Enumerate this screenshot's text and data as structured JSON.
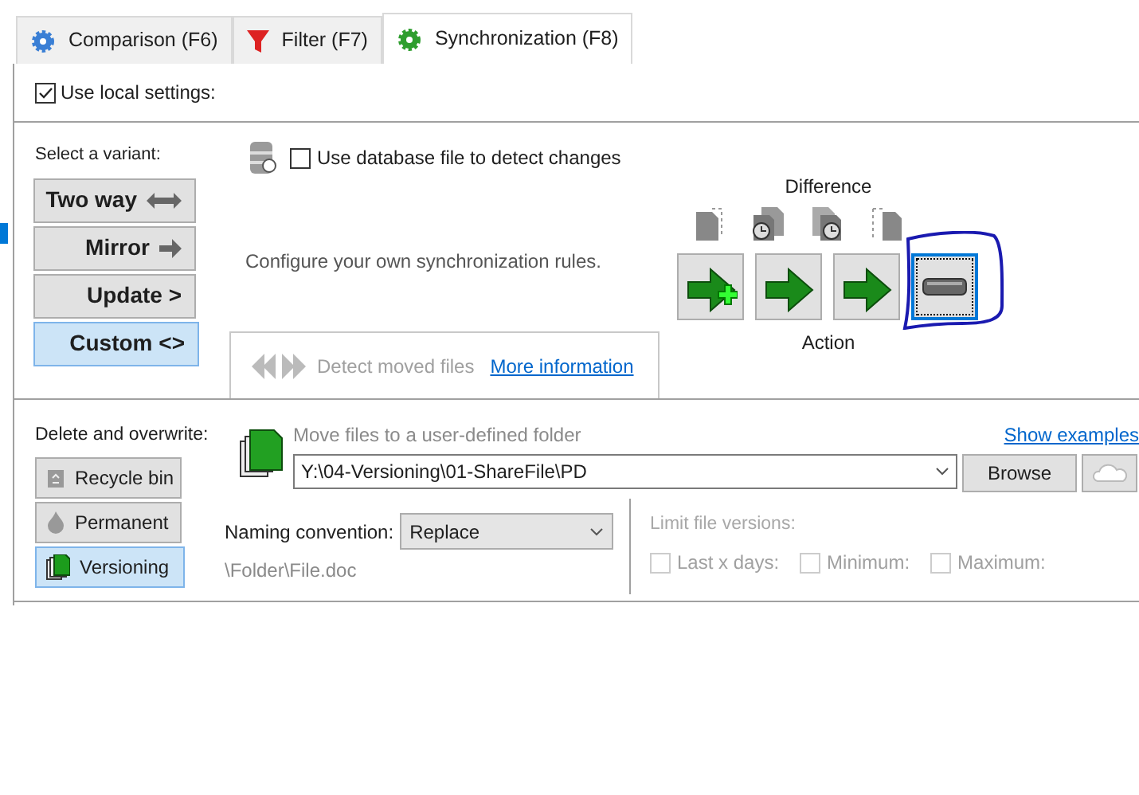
{
  "tabs": [
    {
      "label": "Comparison (F6)",
      "kind": "gear",
      "selected": false
    },
    {
      "label": "Filter (F7)",
      "kind": "funnel",
      "selected": false
    },
    {
      "label": "Synchronization (F8)",
      "kind": "sync",
      "selected": true
    }
  ],
  "local_settings": {
    "label": "Use local settings:",
    "checked": true
  },
  "variants": {
    "label": "Select a variant:",
    "options": [
      {
        "label": "Two way",
        "kind": "two_way",
        "selected": false
      },
      {
        "label": "Mirror",
        "kind": "mirror",
        "selected": false
      },
      {
        "label": "Update >",
        "kind": "text",
        "selected": false
      },
      {
        "label": "Custom <>",
        "kind": "text",
        "selected": true
      }
    ]
  },
  "database": {
    "label": "Use database file to detect changes",
    "checked": false
  },
  "description": "Configure your own synchronization rules.",
  "detect_moved": {
    "label": "Detect moved files",
    "disabled": true,
    "link": "More information"
  },
  "difference_label": "Difference",
  "actions": [
    {
      "kind": "create",
      "selected": false
    },
    {
      "kind": "update",
      "selected": false
    },
    {
      "kind": "update",
      "selected": false
    },
    {
      "kind": "none",
      "selected": true
    }
  ],
  "action_label": "Action",
  "deletion": {
    "label": "Delete and overwrite:",
    "options": [
      {
        "label": "Recycle bin",
        "kind": "recycle",
        "selected": false
      },
      {
        "label": "Permanent",
        "kind": "flame",
        "selected": false
      },
      {
        "label": "Versioning",
        "kind": "versioning",
        "selected": true
      }
    ]
  },
  "versioning": {
    "title": "Move files to a user-defined folder",
    "link": "Show examples",
    "folder": "Y:\\04-Versioning\\01-ShareFile\\PD",
    "browse": "Browse",
    "naming_label": "Naming convention:",
    "naming_value": "Replace",
    "example": "\\Folder\\File.doc"
  },
  "limit": {
    "label": "Limit file versions:",
    "disabled": true,
    "options": [
      {
        "label": "Last x days:",
        "checked": false
      },
      {
        "label": "Minimum:",
        "checked": false
      },
      {
        "label": "Maximum:",
        "checked": false
      }
    ]
  }
}
